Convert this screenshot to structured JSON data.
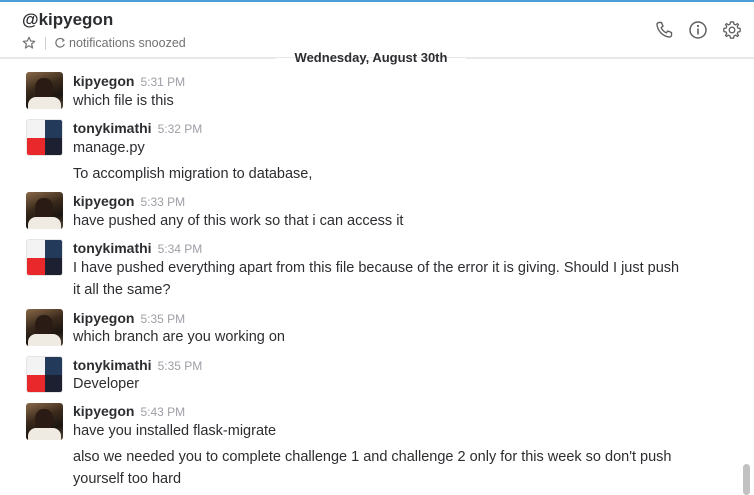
{
  "header": {
    "title": "@kipyegon",
    "status": "notifications snoozed",
    "icons": [
      "star-icon",
      "snooze-icon",
      "phone-icon",
      "info-icon",
      "gear-icon"
    ]
  },
  "date_divider": "Wednesday, August 30th",
  "messages": [
    {
      "sender": "kipyegon",
      "time": "5:31 PM",
      "lines": [
        "which file is this"
      ]
    },
    {
      "sender": "tonykimathi",
      "time": "5:32 PM",
      "lines": [
        "manage.py",
        "To accomplish migration to database,"
      ]
    },
    {
      "sender": "kipyegon",
      "time": "5:33 PM",
      "lines": [
        "have pushed any of this work so that i can access it"
      ]
    },
    {
      "sender": "tonykimathi",
      "time": "5:34 PM",
      "lines": [
        "I have pushed everything apart from this file because of the error it is giving. Should I just push",
        "it all the same?"
      ]
    },
    {
      "sender": "kipyegon",
      "time": "5:35 PM",
      "lines": [
        "which branch are you working on"
      ]
    },
    {
      "sender": "tonykimathi",
      "time": "5:35 PM",
      "lines": [
        "Developer"
      ]
    },
    {
      "sender": "kipyegon",
      "time": "5:43 PM",
      "lines": [
        "have you installed flask-migrate",
        "also we needed you to complete challenge 1 and challenge 2 only for this week so don't push",
        "yourself too hard"
      ]
    }
  ],
  "colors": {
    "accent": "#4a9fd8",
    "text": "#2c2d30",
    "muted": "#9e9ea6"
  }
}
